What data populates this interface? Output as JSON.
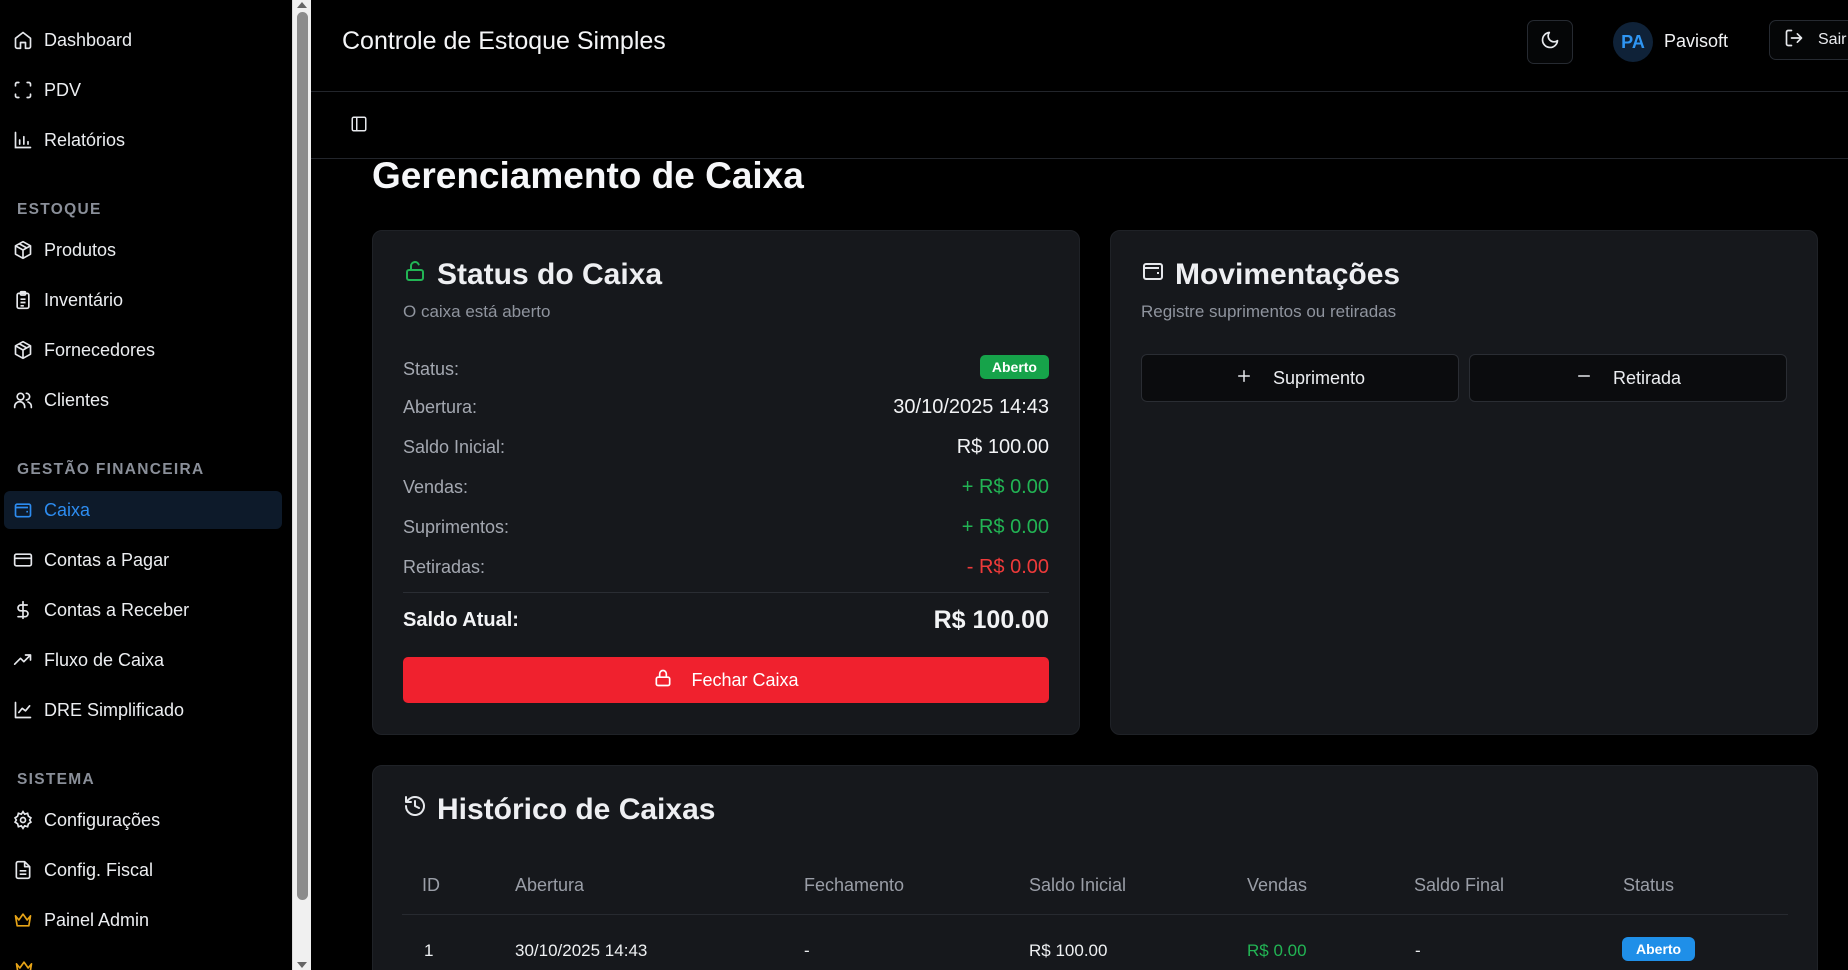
{
  "sidebar": {
    "items_main": [
      {
        "label": "Dashboard",
        "icon": "home-icon"
      },
      {
        "label": "PDV",
        "icon": "scan-icon"
      },
      {
        "label": "Relatórios",
        "icon": "bar-chart-icon"
      }
    ],
    "section_estoque": "ESTOQUE",
    "items_estoque": [
      {
        "label": "Produtos",
        "icon": "package-icon"
      },
      {
        "label": "Inventário",
        "icon": "clipboard-icon"
      },
      {
        "label": "Fornecedores",
        "icon": "package-icon"
      },
      {
        "label": "Clientes",
        "icon": "users-icon"
      }
    ],
    "section_financeira": "GESTÃO FINANCEIRA",
    "items_financeira": [
      {
        "label": "Caixa",
        "icon": "wallet-icon",
        "active": true
      },
      {
        "label": "Contas a Pagar",
        "icon": "credit-card-icon"
      },
      {
        "label": "Contas a Receber",
        "icon": "dollar-icon"
      },
      {
        "label": "Fluxo de Caixa",
        "icon": "trending-up-icon"
      },
      {
        "label": "DRE Simplificado",
        "icon": "line-chart-icon"
      }
    ],
    "section_sistema": "SISTEMA",
    "items_sistema": [
      {
        "label": "Configurações",
        "icon": "gear-icon"
      },
      {
        "label": "Config. Fiscal",
        "icon": "file-icon"
      },
      {
        "label": "Painel Admin",
        "icon": "crown-icon"
      }
    ],
    "accent_color": "#2d8cf0",
    "admin_color": "#e7a417"
  },
  "header": {
    "title": "Controle de Estoque Simples",
    "avatar_initials": "PA",
    "user_name": "Pavisoft",
    "logout_label": "Sair"
  },
  "page": {
    "title": "Gerenciamento de Caixa"
  },
  "status_card": {
    "title": "Status do Caixa",
    "subtitle": "O caixa está aberto",
    "status_label": "Status:",
    "status_badge": "Aberto",
    "abertura_label": "Abertura:",
    "abertura_value": "30/10/2025 14:43",
    "saldo_inicial_label": "Saldo Inicial:",
    "saldo_inicial_value": "R$ 100.00",
    "vendas_label": "Vendas:",
    "vendas_value": "+ R$ 0.00",
    "suprimentos_label": "Suprimentos:",
    "suprimentos_value": "+ R$ 0.00",
    "retiradas_label": "Retiradas:",
    "retiradas_value": "- R$ 0.00",
    "saldo_atual_label": "Saldo Atual:",
    "saldo_atual_value": "R$ 100.00",
    "close_button": "Fechar Caixa"
  },
  "mov_card": {
    "title": "Movimentações",
    "subtitle": "Registre suprimentos ou retiradas",
    "suprimento_button": "Suprimento",
    "retirada_button": "Retirada"
  },
  "history_card": {
    "title": "Histórico de Caixas",
    "columns": [
      "ID",
      "Abertura",
      "Fechamento",
      "Saldo Inicial",
      "Vendas",
      "Saldo Final",
      "Status"
    ],
    "rows": [
      {
        "id": "1",
        "abertura": "30/10/2025 14:43",
        "fechamento": "-",
        "saldo_inicial": "R$ 100.00",
        "vendas": "R$ 0.00",
        "saldo_final": "-",
        "status": "Aberto"
      }
    ]
  }
}
